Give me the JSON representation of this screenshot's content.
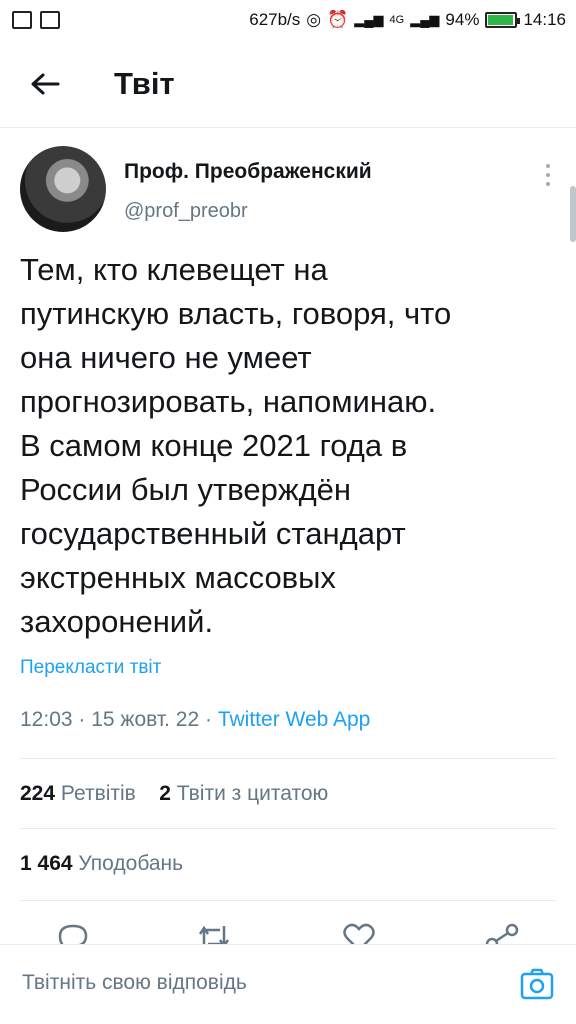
{
  "status_bar": {
    "network_speed": "627b/s",
    "network_type": "4G",
    "battery": "94%",
    "time": "14:16",
    "battery_level": 0.94,
    "battery_color": "#2fb84a"
  },
  "header": {
    "title": "Твіт",
    "back_icon": "arrow-left-icon"
  },
  "tweet": {
    "author_name": "Проф. Преображенский",
    "author_handle": "@prof_preobr",
    "text": "Тем, кто клевещет на\nпутинскую власть, говоря, что\nона ничего не умеет\nпрогнозировать, напоминаю.\nВ самом конце 2021 года в\nРоссии был утверждён\nгосударственный стандарт\nэкстренных массовых\nзахоронений.",
    "translate_label": "Перекласти твіт",
    "time": "12:03",
    "date": "15 жовт. 22",
    "source": "Twitter Web App",
    "retweets_count": "224",
    "retweets_label": "Ретвітів",
    "quotes_count": "2",
    "quotes_label": "Твіти з цитатою",
    "likes_count": "1 464",
    "likes_label": "Уподобань"
  },
  "reply_bar": {
    "placeholder": "Твітніть свою відповідь"
  },
  "colors": {
    "accent": "#1da1f2",
    "secondary_text": "#657786",
    "divider": "#e6ecf0"
  }
}
